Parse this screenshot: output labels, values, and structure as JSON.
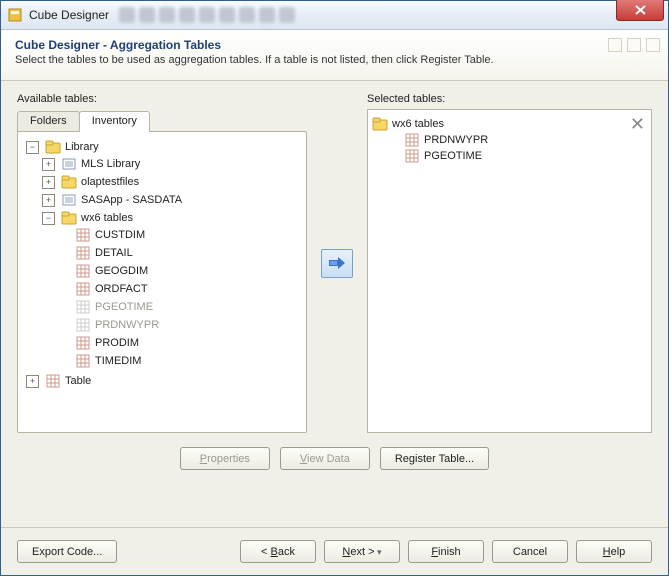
{
  "window_title": "Cube Designer",
  "header": {
    "title": "Cube Designer - Aggregation Tables",
    "hint": "Select the tables to be used as aggregation tables. If a table is not listed, then click Register Table."
  },
  "labels": {
    "available": "Available tables:",
    "selected": "Selected tables:"
  },
  "tabs": {
    "folders": "Folders",
    "inventory": "Inventory"
  },
  "tree": {
    "root": "Library",
    "mls": "MLS Library",
    "olap": "olaptestfiles",
    "sasapp": "SASApp - SASDATA",
    "wx6": "wx6 tables",
    "items": {
      "custdim": "CUSTDIM",
      "detail": "DETAIL",
      "geogdim": "GEOGDIM",
      "ordfact": "ORDFACT",
      "pgeotime": "PGEOTIME",
      "prdnwypr": "PRDNWYPR",
      "prodim": "PRODIM",
      "timedim": "TIMEDIM"
    },
    "table": "Table"
  },
  "selected": {
    "group": "wx6 tables",
    "a": "PRDNWYPR",
    "b": "PGEOTIME"
  },
  "mid_buttons": {
    "properties": "Properties",
    "viewdata": "View Data",
    "register": "Register Table..."
  },
  "footer": {
    "export": "Export Code...",
    "back": "< Back",
    "next": "Next >",
    "finish": "Finish",
    "cancel": "Cancel",
    "help": "Help"
  }
}
